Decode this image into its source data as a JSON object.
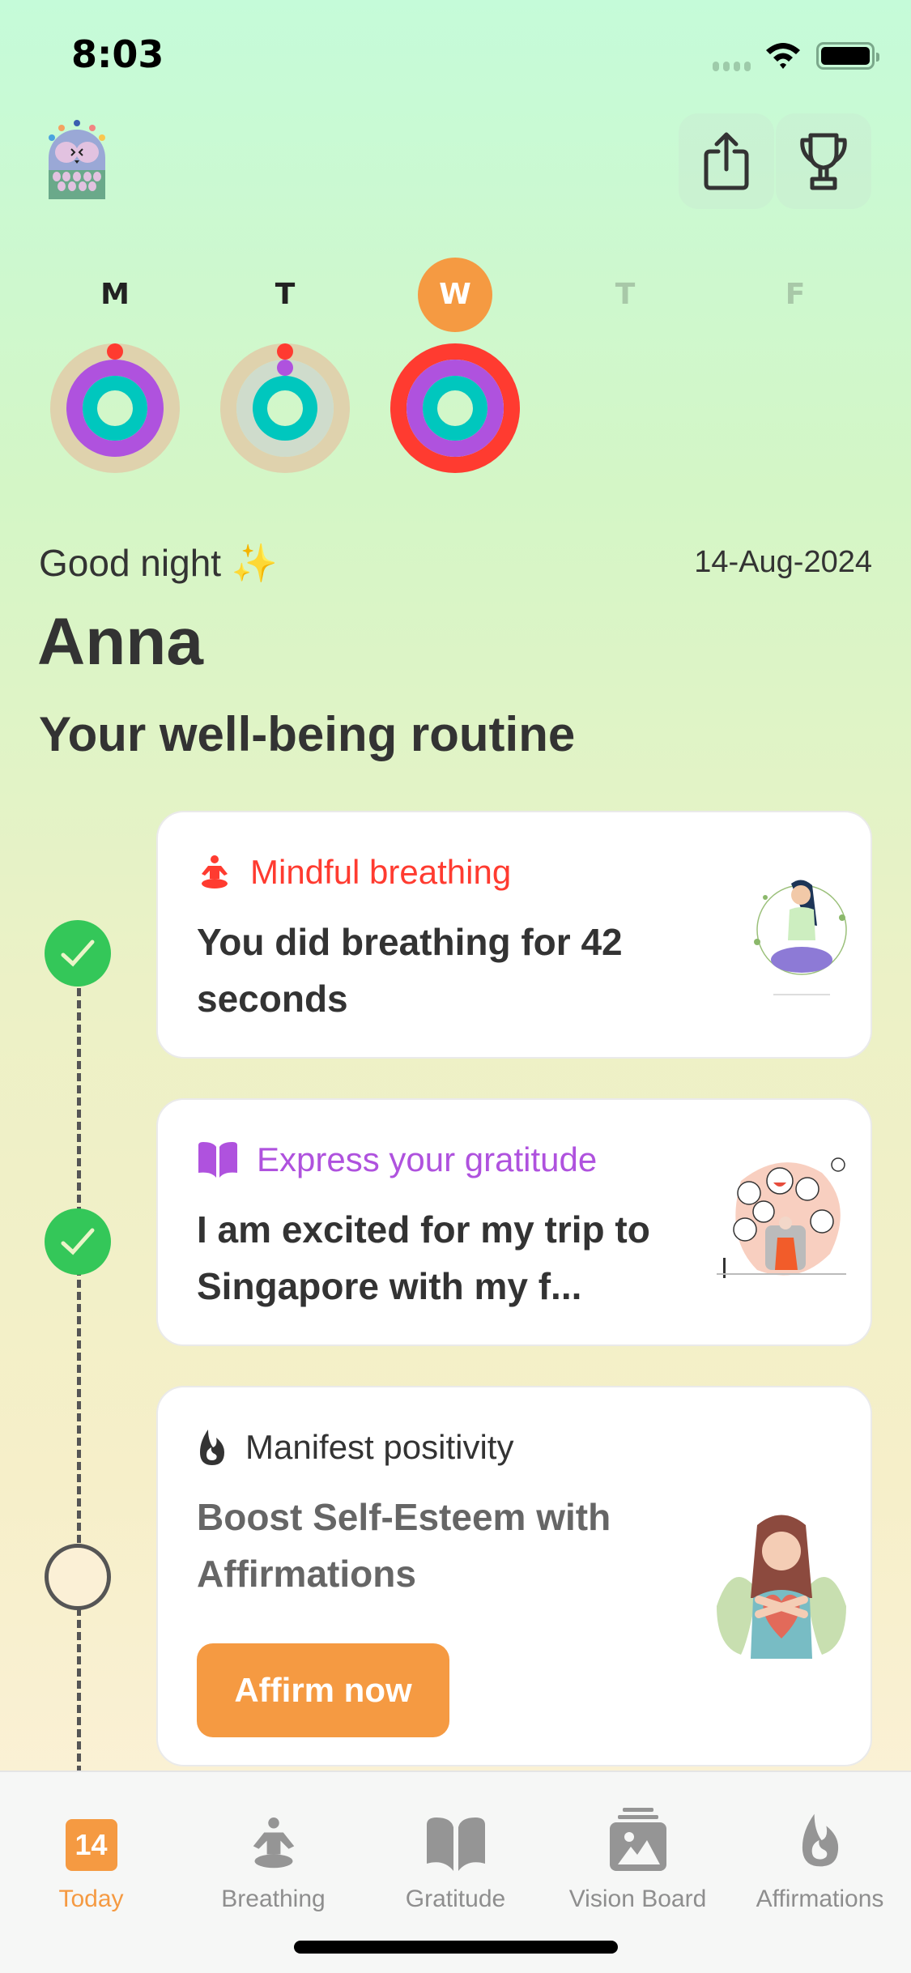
{
  "status_bar": {
    "time": "8:03"
  },
  "header": {
    "share_icon": "share-icon",
    "trophy_icon": "trophy-icon",
    "avatar": "owl-avatar"
  },
  "week": {
    "days": [
      {
        "label": "M",
        "state": "past",
        "rings": {
          "outer": 0,
          "middle": 1,
          "inner": 1
        }
      },
      {
        "label": "T",
        "state": "past",
        "rings": {
          "outer": 0,
          "middle": 0,
          "inner": 1
        }
      },
      {
        "label": "W",
        "state": "today",
        "rings": {
          "outer": 1,
          "middle": 1,
          "inner": 1
        }
      },
      {
        "label": "T",
        "state": "future"
      },
      {
        "label": "F",
        "state": "future"
      }
    ],
    "colors": {
      "outer": "#ff3b30",
      "middle": "#af52de",
      "inner": "#00c7be",
      "track": "#dfd2ad",
      "today": "#f59a42"
    }
  },
  "greeting": "Good night ✨",
  "date": "14-Aug-2024",
  "name": "Anna",
  "routine_title": "Your well-being routine",
  "routine": [
    {
      "status": "done",
      "icon": "meditation-icon",
      "title": "Mindful breathing",
      "title_color": "#ff3b30",
      "body": "You did breathing for 42 seconds"
    },
    {
      "status": "done",
      "icon": "book-icon",
      "title": "Express your gratitude",
      "title_color": "#af52de",
      "body": "I am excited for my trip to Singapore with my f..."
    },
    {
      "status": "todo",
      "icon": "flame-icon",
      "title": "Manifest positivity",
      "title_color": "#333333",
      "body": "Boost Self-Esteem with Affirmations",
      "button": "Affirm now"
    }
  ],
  "tabbar": {
    "tabs": [
      {
        "label": "Today",
        "badge": "14",
        "active": true
      },
      {
        "label": "Breathing",
        "active": false
      },
      {
        "label": "Gratitude",
        "active": false
      },
      {
        "label": "Vision Board",
        "active": false
      },
      {
        "label": "Affirmations",
        "active": false
      }
    ]
  }
}
